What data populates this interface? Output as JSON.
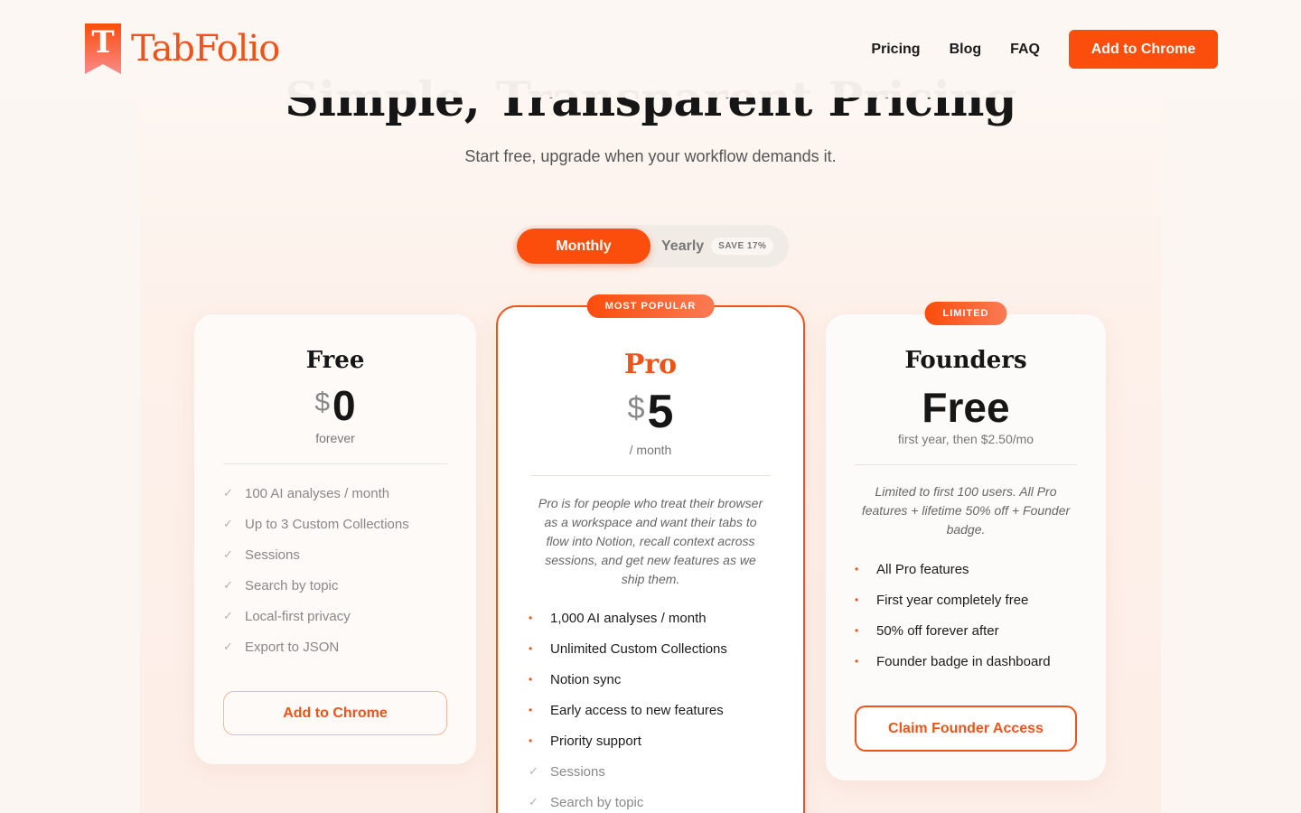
{
  "brand": {
    "name": "TabFolio",
    "logo_letter": "T",
    "accent": "#fb4d0b"
  },
  "nav": {
    "links": [
      "Pricing",
      "Blog",
      "FAQ"
    ],
    "cta": "Add to Chrome"
  },
  "hero": {
    "title": "Simple, Transparent Pricing",
    "subtitle": "Start free, upgrade when your workflow demands it."
  },
  "billing_toggle": {
    "monthly": "Monthly",
    "yearly": "Yearly",
    "save_badge": "SAVE 17%",
    "selected": "Monthly"
  },
  "plans": {
    "free": {
      "name": "Free",
      "currency": "$",
      "amount": "0",
      "period": "forever",
      "features": [
        "100 AI analyses / month",
        "Up to 3 Custom Collections",
        "Sessions",
        "Search by topic",
        "Local-first privacy",
        "Export to JSON"
      ],
      "cta": "Add to Chrome"
    },
    "pro": {
      "badge": "MOST POPULAR",
      "name": "Pro",
      "currency": "$",
      "amount": "5",
      "period": "/ month",
      "description": "Pro is for people who treat their browser as a workspace and want their tabs to flow into Notion, recall context across sessions, and get new features as we ship them.",
      "highlight_features": [
        "1,000 AI analyses / month",
        "Unlimited Custom Collections",
        "Notion sync",
        "Early access to new features",
        "Priority support"
      ],
      "base_features": [
        "Sessions",
        "Search by topic"
      ]
    },
    "founders": {
      "badge": "LIMITED",
      "name": "Founders",
      "amount": "Free",
      "period": "first year, then $2.50/mo",
      "description": "Limited to first 100 users. All Pro features + lifetime 50% off + Founder badge.",
      "features": [
        "All Pro features",
        "First year completely free",
        "50% off forever after",
        "Founder badge in dashboard"
      ],
      "cta": "Claim Founder Access"
    }
  },
  "icons": {
    "check": "✓",
    "bullet": "•"
  }
}
